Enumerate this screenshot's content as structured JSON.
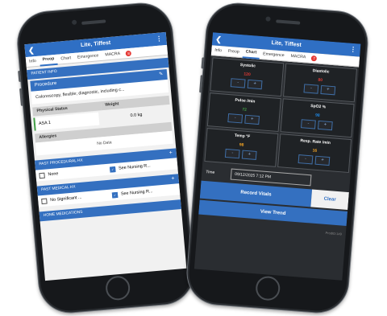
{
  "colors": {
    "accent": "#3470c0",
    "online": "#4caf50",
    "badge": "#e53935",
    "asa_marker": "#43a047",
    "systolic": "#e53935",
    "diastolic": "#e53935",
    "pulse": "#43a047",
    "spo2": "#1e88e5",
    "temp": "#f9a825",
    "resp": "#f9a825"
  },
  "left": {
    "header": {
      "title": "Lite, Tiffest"
    },
    "tabs": [
      {
        "label": "Info"
      },
      {
        "label": "Preop"
      },
      {
        "label": "Chart"
      },
      {
        "label": "Emergence"
      },
      {
        "label": "MACRA"
      }
    ],
    "badge": "8",
    "patient_info": {
      "label": "PATIENT INFO"
    },
    "procedure": {
      "label": "Procedure",
      "value": "Colonoscopy, flexible; diagnostic, including c..."
    },
    "physical_status": {
      "label": "Physical Status",
      "value": "ASA 1"
    },
    "weight": {
      "label": "Weight",
      "value": "0.0 kg"
    },
    "allergies": {
      "label": "Allergies",
      "value": "No Data"
    },
    "past_proc": {
      "label": "PAST PROCEDURAL HX",
      "opt1": "None",
      "opt2": "See Nursing R..."
    },
    "past_med": {
      "label": "PAST MEDICAL HX",
      "opt1": "No Significant ...",
      "opt2": "See Nursing R..."
    },
    "home_meds": {
      "label": "HOME MEDICATIONS"
    }
  },
  "right": {
    "header": {
      "title": "Lite, Tiffest"
    },
    "tabs": [
      {
        "label": "Info"
      },
      {
        "label": "Preop"
      },
      {
        "label": "Chart"
      },
      {
        "label": "Emergence"
      },
      {
        "label": "MACRA"
      }
    ],
    "badge": "7",
    "vitals": [
      {
        "title": "Systolic",
        "value": "120"
      },
      {
        "title": "Diastolic",
        "value": "80"
      },
      {
        "title": "Pulse /min",
        "value": "72"
      },
      {
        "title": "SpO2 %",
        "value": "98"
      },
      {
        "title": "Temp °F",
        "value": "98"
      },
      {
        "title": "Resp. Rate /min",
        "value": "16"
      }
    ],
    "time_label": "Time",
    "time_value": "09/12/2025 7:12 PM",
    "record_label": "Record Vitals",
    "clear_label": "Clear",
    "trend_label": "View Trend",
    "product": "ProdID:149"
  },
  "icons": {
    "back": "back-arrow-icon",
    "menu": "kebab-menu-icon",
    "edit": "pencil-icon",
    "add": "plus-icon",
    "calendar": "calendar-icon"
  }
}
